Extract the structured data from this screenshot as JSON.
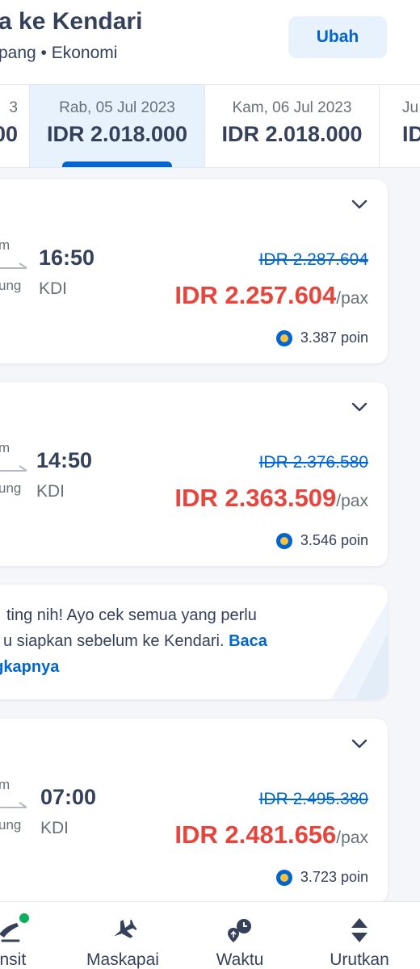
{
  "header": {
    "title": "a ke Kendari",
    "subtitle": "pang • Ekonomi",
    "change_label": "Ubah"
  },
  "date_tabs": [
    {
      "date": "3",
      "price": "00",
      "active": false
    },
    {
      "date": "Rab, 05 Jul 2023",
      "price": "IDR 2.018.000",
      "active": true
    },
    {
      "date": "Kam, 06 Jul 2023",
      "price": "IDR 2.018.000",
      "active": false
    },
    {
      "date": "Ju",
      "price": "IDF",
      "active": false
    }
  ],
  "flights": [
    {
      "dep_fragment": "m",
      "dur_fragment": "ung",
      "arrival_time": "16:50",
      "arrival_code": "KDI",
      "old_price": "IDR 2.287.604",
      "price": "IDR 2.257.604",
      "unit": "/pax",
      "points": "3.387 poin"
    },
    {
      "dep_fragment": "m",
      "dur_fragment": "ung",
      "arrival_time": "14:50",
      "arrival_code": "KDI",
      "old_price": "IDR 2.376.580",
      "price": "IDR 2.363.509",
      "unit": "/pax",
      "points": "3.546 poin"
    },
    {
      "dep_fragment": "m",
      "dur_fragment": "ung",
      "arrival_time": "07:00",
      "arrival_code": "KDI",
      "old_price": "IDR 2.495.380",
      "price": "IDR 2.481.656",
      "unit": "/pax",
      "points": "3.723 poin"
    }
  ],
  "info_banner": {
    "line1": "ting nih! Ayo cek semua yang perlu",
    "line2": "u siapkan sebelum ke Kendari.",
    "link_part1": "Baca",
    "link_part2": "ngkapnya"
  },
  "bottom_nav": [
    {
      "label": "ansit",
      "icon": "transit-icon"
    },
    {
      "label": "Maskapai",
      "icon": "airplane-icon"
    },
    {
      "label": "Waktu",
      "icon": "time-icon"
    },
    {
      "label": "Urutkan",
      "icon": "sort-icon"
    }
  ],
  "colors": {
    "accent": "#0064d2",
    "price_red": "#e7453c",
    "text": "#35405a",
    "badge_green": "#0bb05e"
  }
}
